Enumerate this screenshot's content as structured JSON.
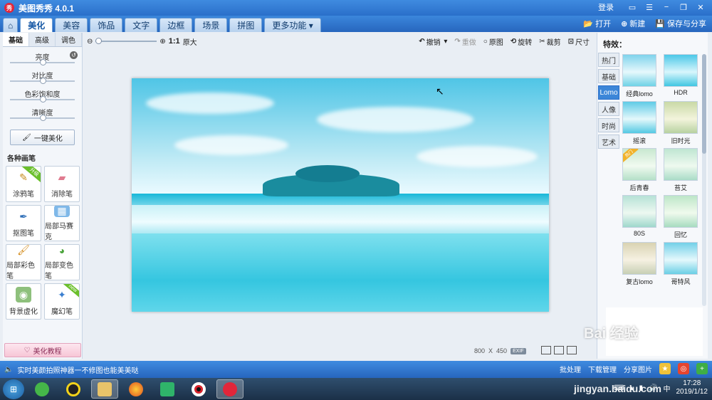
{
  "app": {
    "title": "美图秀秀 4.0.1",
    "logo_text": "秀"
  },
  "window": {
    "login": "登录"
  },
  "menu": {
    "tabs": [
      {
        "label": "美化"
      },
      {
        "label": "美容"
      },
      {
        "label": "饰品"
      },
      {
        "label": "文字"
      },
      {
        "label": "边框"
      },
      {
        "label": "场景"
      },
      {
        "label": "拼图"
      },
      {
        "label": "更多功能"
      }
    ],
    "open": "打开",
    "new": "新建",
    "save": "保存与分享"
  },
  "left": {
    "subtabs": [
      "基础",
      "高级",
      "调色"
    ],
    "sliders": [
      {
        "label": "亮度",
        "value": 0.5
      },
      {
        "label": "对比度",
        "value": 0.5
      },
      {
        "label": "色彩饱和度",
        "value": 0.5
      },
      {
        "label": "清晰度",
        "value": 0.5
      }
    ],
    "onekey": "一键美化",
    "brush_title": "各种画笔",
    "brushes": [
      {
        "label": "涂鸦笔",
        "badge": "升级"
      },
      {
        "label": "消除笔",
        "badge": ""
      },
      {
        "label": "抠图笔",
        "badge": ""
      },
      {
        "label": "局部马赛克",
        "badge": ""
      },
      {
        "label": "局部彩色笔",
        "badge": ""
      },
      {
        "label": "局部变色笔",
        "badge": ""
      },
      {
        "label": "背景虚化",
        "badge": ""
      },
      {
        "label": "魔幻笔",
        "badge": "new"
      }
    ],
    "tutorial": "美化教程"
  },
  "toolbar": {
    "zoom_ratio": "1:1",
    "original_size": "原大",
    "undo": "撤销",
    "redo": "重做",
    "original": "原图",
    "rotate": "旋转",
    "crop": "裁剪",
    "resize": "尺寸"
  },
  "image": {
    "width": "800",
    "times": "X",
    "height": "450",
    "exif": "EXIF"
  },
  "right": {
    "title": "特效：",
    "categories": [
      "热门",
      "基础",
      "Lomo",
      "人像",
      "时尚",
      "艺术"
    ],
    "effects": [
      {
        "label": "经典lomo",
        "hot": ""
      },
      {
        "label": "HDR",
        "hot": ""
      },
      {
        "label": "摇滚",
        "hot": ""
      },
      {
        "label": "旧时光",
        "hot": ""
      },
      {
        "label": "后青春",
        "hot": "热门"
      },
      {
        "label": "苔艾",
        "hot": ""
      },
      {
        "label": "80S",
        "hot": ""
      },
      {
        "label": "回忆",
        "hot": ""
      },
      {
        "label": "复古lomo",
        "hot": ""
      },
      {
        "label": "哥特风",
        "hot": ""
      }
    ]
  },
  "status": {
    "message": "实时美颜拍照神器一不修图也能美美哒",
    "batch": "批处理",
    "download": "下载管理",
    "share": "分享图片"
  },
  "taskbar": {
    "time": "17:28",
    "date": "2019/1/12"
  },
  "watermark": {
    "brand": "Bai 经验",
    "url": "jingyan.baidu.com"
  }
}
